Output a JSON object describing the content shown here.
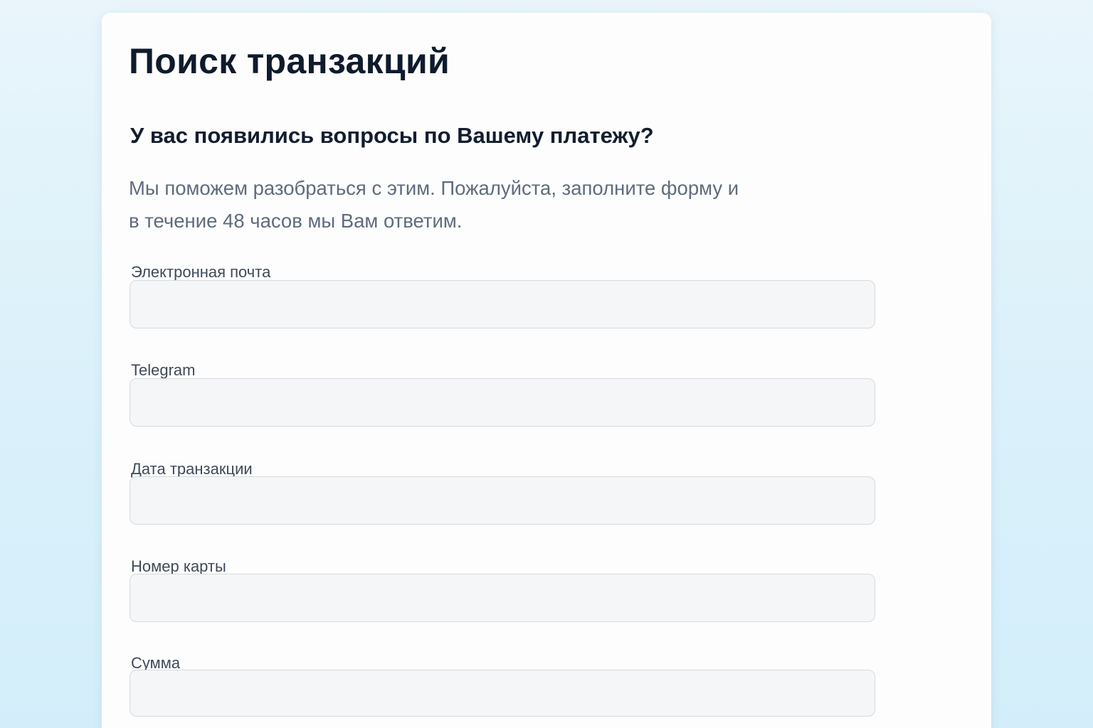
{
  "page": {
    "title": "Поиск транзакций",
    "subtitle": "У вас появились вопросы по Вашему платежу?",
    "description": "Мы поможем разобраться с этим. Пожалуйста, заполните форму и в течение 48 часов мы Вам ответим."
  },
  "form": {
    "fields": [
      {
        "label": "Электронная почта",
        "value": ""
      },
      {
        "label": "Telegram",
        "value": ""
      },
      {
        "label": "Дата транзакции",
        "value": ""
      },
      {
        "label": "Номер карты",
        "value": ""
      },
      {
        "label": "Сумма",
        "value": ""
      }
    ]
  },
  "colors": {
    "title": "#0f1b2d",
    "description": "#5f6c7e",
    "input_background": "#f5f6f7",
    "input_border": "#d6d9dd",
    "page_background": "#dcf1fa"
  }
}
